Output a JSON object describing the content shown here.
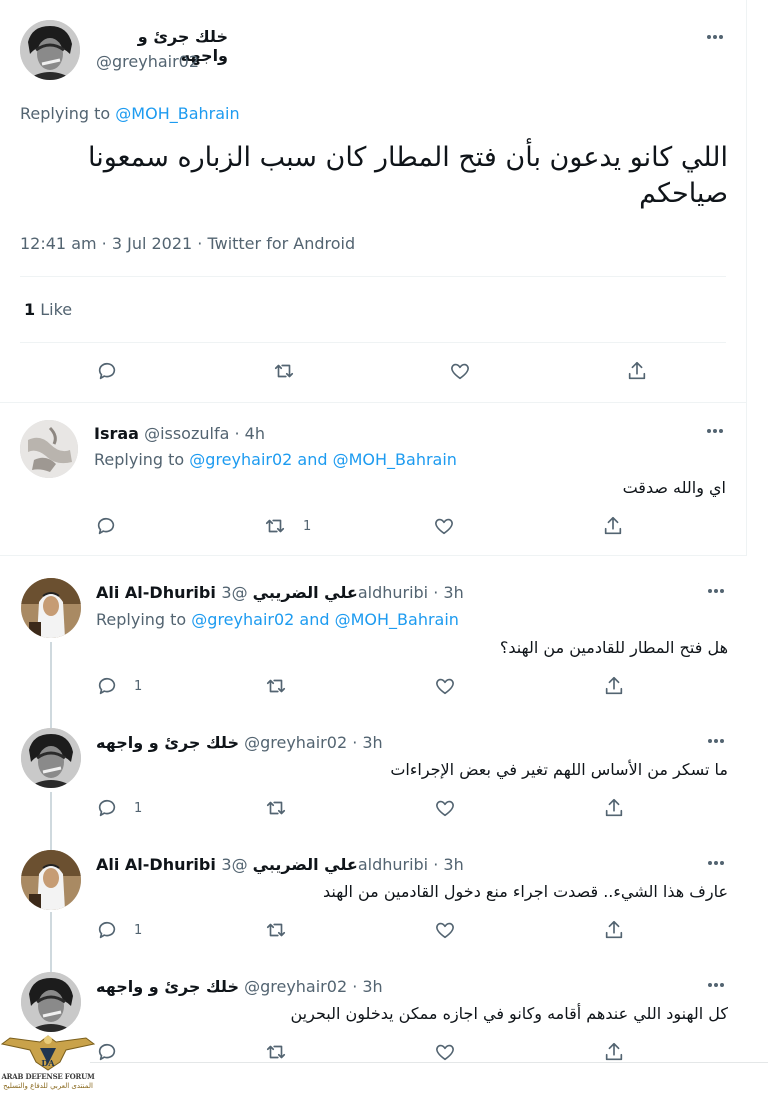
{
  "main_tweet": {
    "name": "خلك جرئ و واجهه",
    "handle": "@greyhair02",
    "replying_prefix": "Replying to",
    "replying_to": "@MOH_Bahrain",
    "text": "اللي كانو يدعون بأن فتح المطار كان سبب الزباره سمعونا صياحكم",
    "meta": "12:41 am · 3 Jul 2021 · Twitter for Android",
    "likes_count": "1",
    "likes_label": "Like"
  },
  "replies": [
    {
      "name": "Israa",
      "handle": "@issozulfa · 4h",
      "replying_prefix": "Replying to",
      "replying_to_1": "@greyhair02",
      "and_word": "and",
      "replying_to_2": "@MOH_Bahrain",
      "text": "اي والله صدقت",
      "retweet_count": "1"
    },
    {
      "name": "Ali Al-Dhuribi علي الضريبي",
      "handle": "@3aldhuribi · 3h",
      "replying_prefix": "Replying to",
      "replying_to_1": "@greyhair02",
      "and_word": "and",
      "replying_to_2": "@MOH_Bahrain",
      "text": "هل فتح المطار للقادمين من الهند؟",
      "reply_count": "1"
    },
    {
      "name": "خلك جرئ و واجهه",
      "handle": "@greyhair02 · 3h",
      "text": "ما تسكر من الأساس اللهم تغير في بعض الإجراءات",
      "reply_count": "1"
    },
    {
      "name": "Ali Al-Dhuribi علي الضريبي",
      "handle": "@3aldhuribi · 3h",
      "text": "عارف هذا الشيء.. قصدت اجراء منع دخول القادمين من الهند",
      "reply_count": "1"
    },
    {
      "name": "خلك جرئ و واجهه",
      "handle": "@greyhair02 · 3h",
      "text": "كل الهنود اللي عندهم أقامه وكانو في اجازه ممكن يدخلون البحرين",
      "reply_count": ""
    }
  ],
  "watermark": {
    "logo_text": "DA",
    "line1": "ARAB DEFENSE FORUM",
    "line2": "المنتدى العربي للدفاع والتسليح"
  },
  "colors": {
    "link": "#1d9bf0",
    "secondary_text": "#536471",
    "divider": "#eff3f4"
  }
}
